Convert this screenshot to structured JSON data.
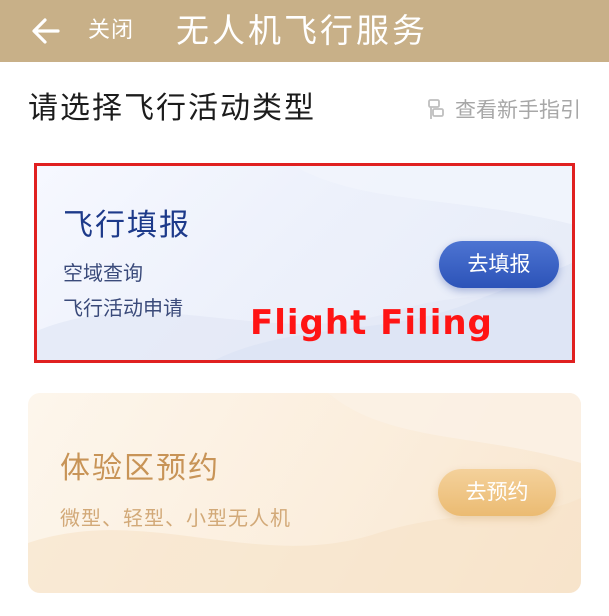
{
  "header": {
    "back_icon": "arrow-left-icon",
    "close_label": "关闭",
    "title": "无人机飞行服务",
    "background_color": "#c8b088"
  },
  "section": {
    "title": "请选择飞行活动类型",
    "guide_icon": "guide-icon",
    "guide_label": "查看新手指引"
  },
  "cards": [
    {
      "title": "飞行填报",
      "lines": [
        "空域查询",
        "飞行活动申请"
      ],
      "button_label": "去填报",
      "accent_color": "#2c53b8",
      "annotation": "Flight Filing",
      "annotation_color": "#ff1414"
    },
    {
      "title": "体验区预约",
      "description": "微型、轻型、小型无人机",
      "button_label": "去预约",
      "accent_color": "#ebbb72"
    }
  ]
}
